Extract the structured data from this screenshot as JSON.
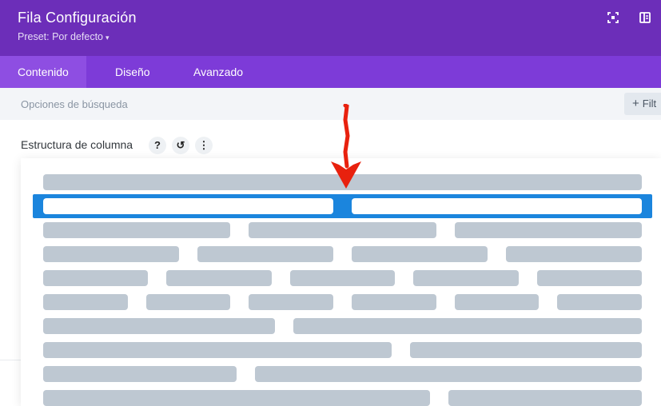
{
  "header": {
    "title": "Fila Configuración",
    "preset_label": "Preset: Por defecto",
    "icons": [
      "fullscreen-icon",
      "split-view-icon"
    ]
  },
  "tabs": [
    {
      "label": "Contenido",
      "active": true
    },
    {
      "label": "Diseño",
      "active": false
    },
    {
      "label": "Avanzado",
      "active": false
    }
  ],
  "search": {
    "placeholder": "Opciones de búsqueda",
    "filter_label": "Filt"
  },
  "structure": {
    "label": "Estructura de columna",
    "help_glyph": "?",
    "reset_glyph": "↺",
    "menu_glyph": "⋮"
  },
  "layout_options": [
    {
      "name": "1 column",
      "columns": [
        1
      ]
    },
    {
      "name": "1/2 + 1/2",
      "columns": [
        1,
        1
      ],
      "selected": true
    },
    {
      "name": "1/3 + 1/3 + 1/3",
      "columns": [
        1,
        1,
        1
      ]
    },
    {
      "name": "1/4 x 4",
      "columns": [
        1,
        1,
        1,
        1
      ]
    },
    {
      "name": "1/5 x 5",
      "columns": [
        1,
        1,
        1,
        1,
        1
      ]
    },
    {
      "name": "1/6 x 6",
      "columns": [
        1,
        1,
        1,
        1,
        1,
        1
      ]
    },
    {
      "name": "2/5 + 3/5",
      "columns": [
        2,
        3
      ]
    },
    {
      "name": "3/5 + 2/5",
      "columns": [
        3,
        2
      ]
    },
    {
      "name": "1/3 + 2/3",
      "columns": [
        1,
        2
      ]
    },
    {
      "name": "2/3 + 1/3",
      "columns": [
        2,
        1
      ]
    }
  ],
  "colors": {
    "header_bg": "#6c2eb9",
    "tabs_bg": "#7d3bd8",
    "active_tab_bg": "#8e4ee2",
    "selected_option": "#1b85dd",
    "option_block": "#bec8d2",
    "annotation_arrow": "#e8210e"
  }
}
